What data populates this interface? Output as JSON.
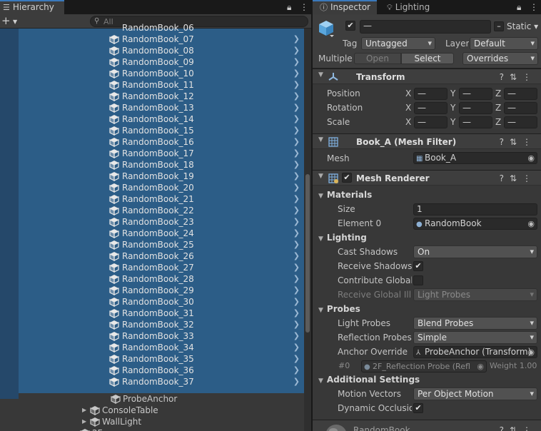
{
  "hierarchy": {
    "tab_title": "Hierarchy",
    "search_placeholder": "All",
    "add_label": "+",
    "top_cut_label": "RandomBook_06",
    "selected_books": [
      "RandomBook_07",
      "RandomBook_08",
      "RandomBook_09",
      "RandomBook_10",
      "RandomBook_11",
      "RandomBook_12",
      "RandomBook_13",
      "RandomBook_14",
      "RandomBook_15",
      "RandomBook_16",
      "RandomBook_17",
      "RandomBook_18",
      "RandomBook_19",
      "RandomBook_20",
      "RandomBook_21",
      "RandomBook_22",
      "RandomBook_23",
      "RandomBook_24",
      "RandomBook_25",
      "RandomBook_26",
      "RandomBook_27",
      "RandomBook_28",
      "RandomBook_29",
      "RandomBook_30",
      "RandomBook_31",
      "RandomBook_32",
      "RandomBook_33",
      "RandomBook_34",
      "RandomBook_35",
      "RandomBook_36",
      "RandomBook_37"
    ],
    "after_rows": [
      {
        "label": "ProbeAnchor",
        "indent": 2
      },
      {
        "label": "ConsoleTable",
        "indent": 1,
        "foldable": true
      },
      {
        "label": "WallLight",
        "indent": 1,
        "foldable": true
      },
      {
        "label": "2F",
        "indent": 0,
        "foldable": true
      }
    ],
    "selection_color": "#2c5d87"
  },
  "inspector": {
    "tabs": {
      "inspector": "Inspector",
      "lighting": "Lighting"
    },
    "header": {
      "name_value": "—",
      "static_label": "Static",
      "tag_label": "Tag",
      "tag_value": "Untagged",
      "layer_label": "Layer",
      "layer_value": "Default",
      "multiple_label": "Multiple",
      "open_label": "Open",
      "select_label": "Select",
      "overrides_label": "Overrides"
    },
    "transform": {
      "title": "Transform",
      "rows": [
        {
          "label": "Position",
          "x": "—",
          "y": "—",
          "z": "—"
        },
        {
          "label": "Rotation",
          "x": "—",
          "y": "—",
          "z": "—"
        },
        {
          "label": "Scale",
          "x": "—",
          "y": "—",
          "z": "—"
        }
      ],
      "axes": [
        "X",
        "Y",
        "Z"
      ]
    },
    "mesh_filter": {
      "title": "Book_A (Mesh Filter)",
      "mesh_label": "Mesh",
      "mesh_value": "Book_A"
    },
    "mesh_renderer": {
      "title": "Mesh Renderer",
      "materials_label": "Materials",
      "size_label": "Size",
      "size_value": "1",
      "element0_label": "Element 0",
      "element0_value": "RandomBook",
      "lighting_label": "Lighting",
      "cast_shadows_label": "Cast Shadows",
      "cast_shadows_value": "On",
      "receive_shadows_label": "Receive Shadows",
      "contribute_gi_label": "Contribute Global I",
      "receive_gi_label": "Receive Global Illu",
      "receive_gi_value": "Light Probes",
      "probes_label": "Probes",
      "light_probes_label": "Light Probes",
      "light_probes_value": "Blend Probes",
      "reflection_probes_label": "Reflection Probes",
      "reflection_probes_value": "Simple",
      "anchor_override_label": "Anchor Override",
      "anchor_override_value": "ProbeAnchor (Transform)",
      "probe_index": "#0",
      "probe_name": "2F_Reflection Probe (Refl",
      "probe_weight": "Weight 1.00",
      "additional_label": "Additional Settings",
      "motion_vectors_label": "Motion Vectors",
      "motion_vectors_value": "Per Object Motion",
      "dynamic_occlusion_label": "Dynamic Occlusion"
    },
    "material_preview": {
      "title": "RandomBook"
    }
  }
}
